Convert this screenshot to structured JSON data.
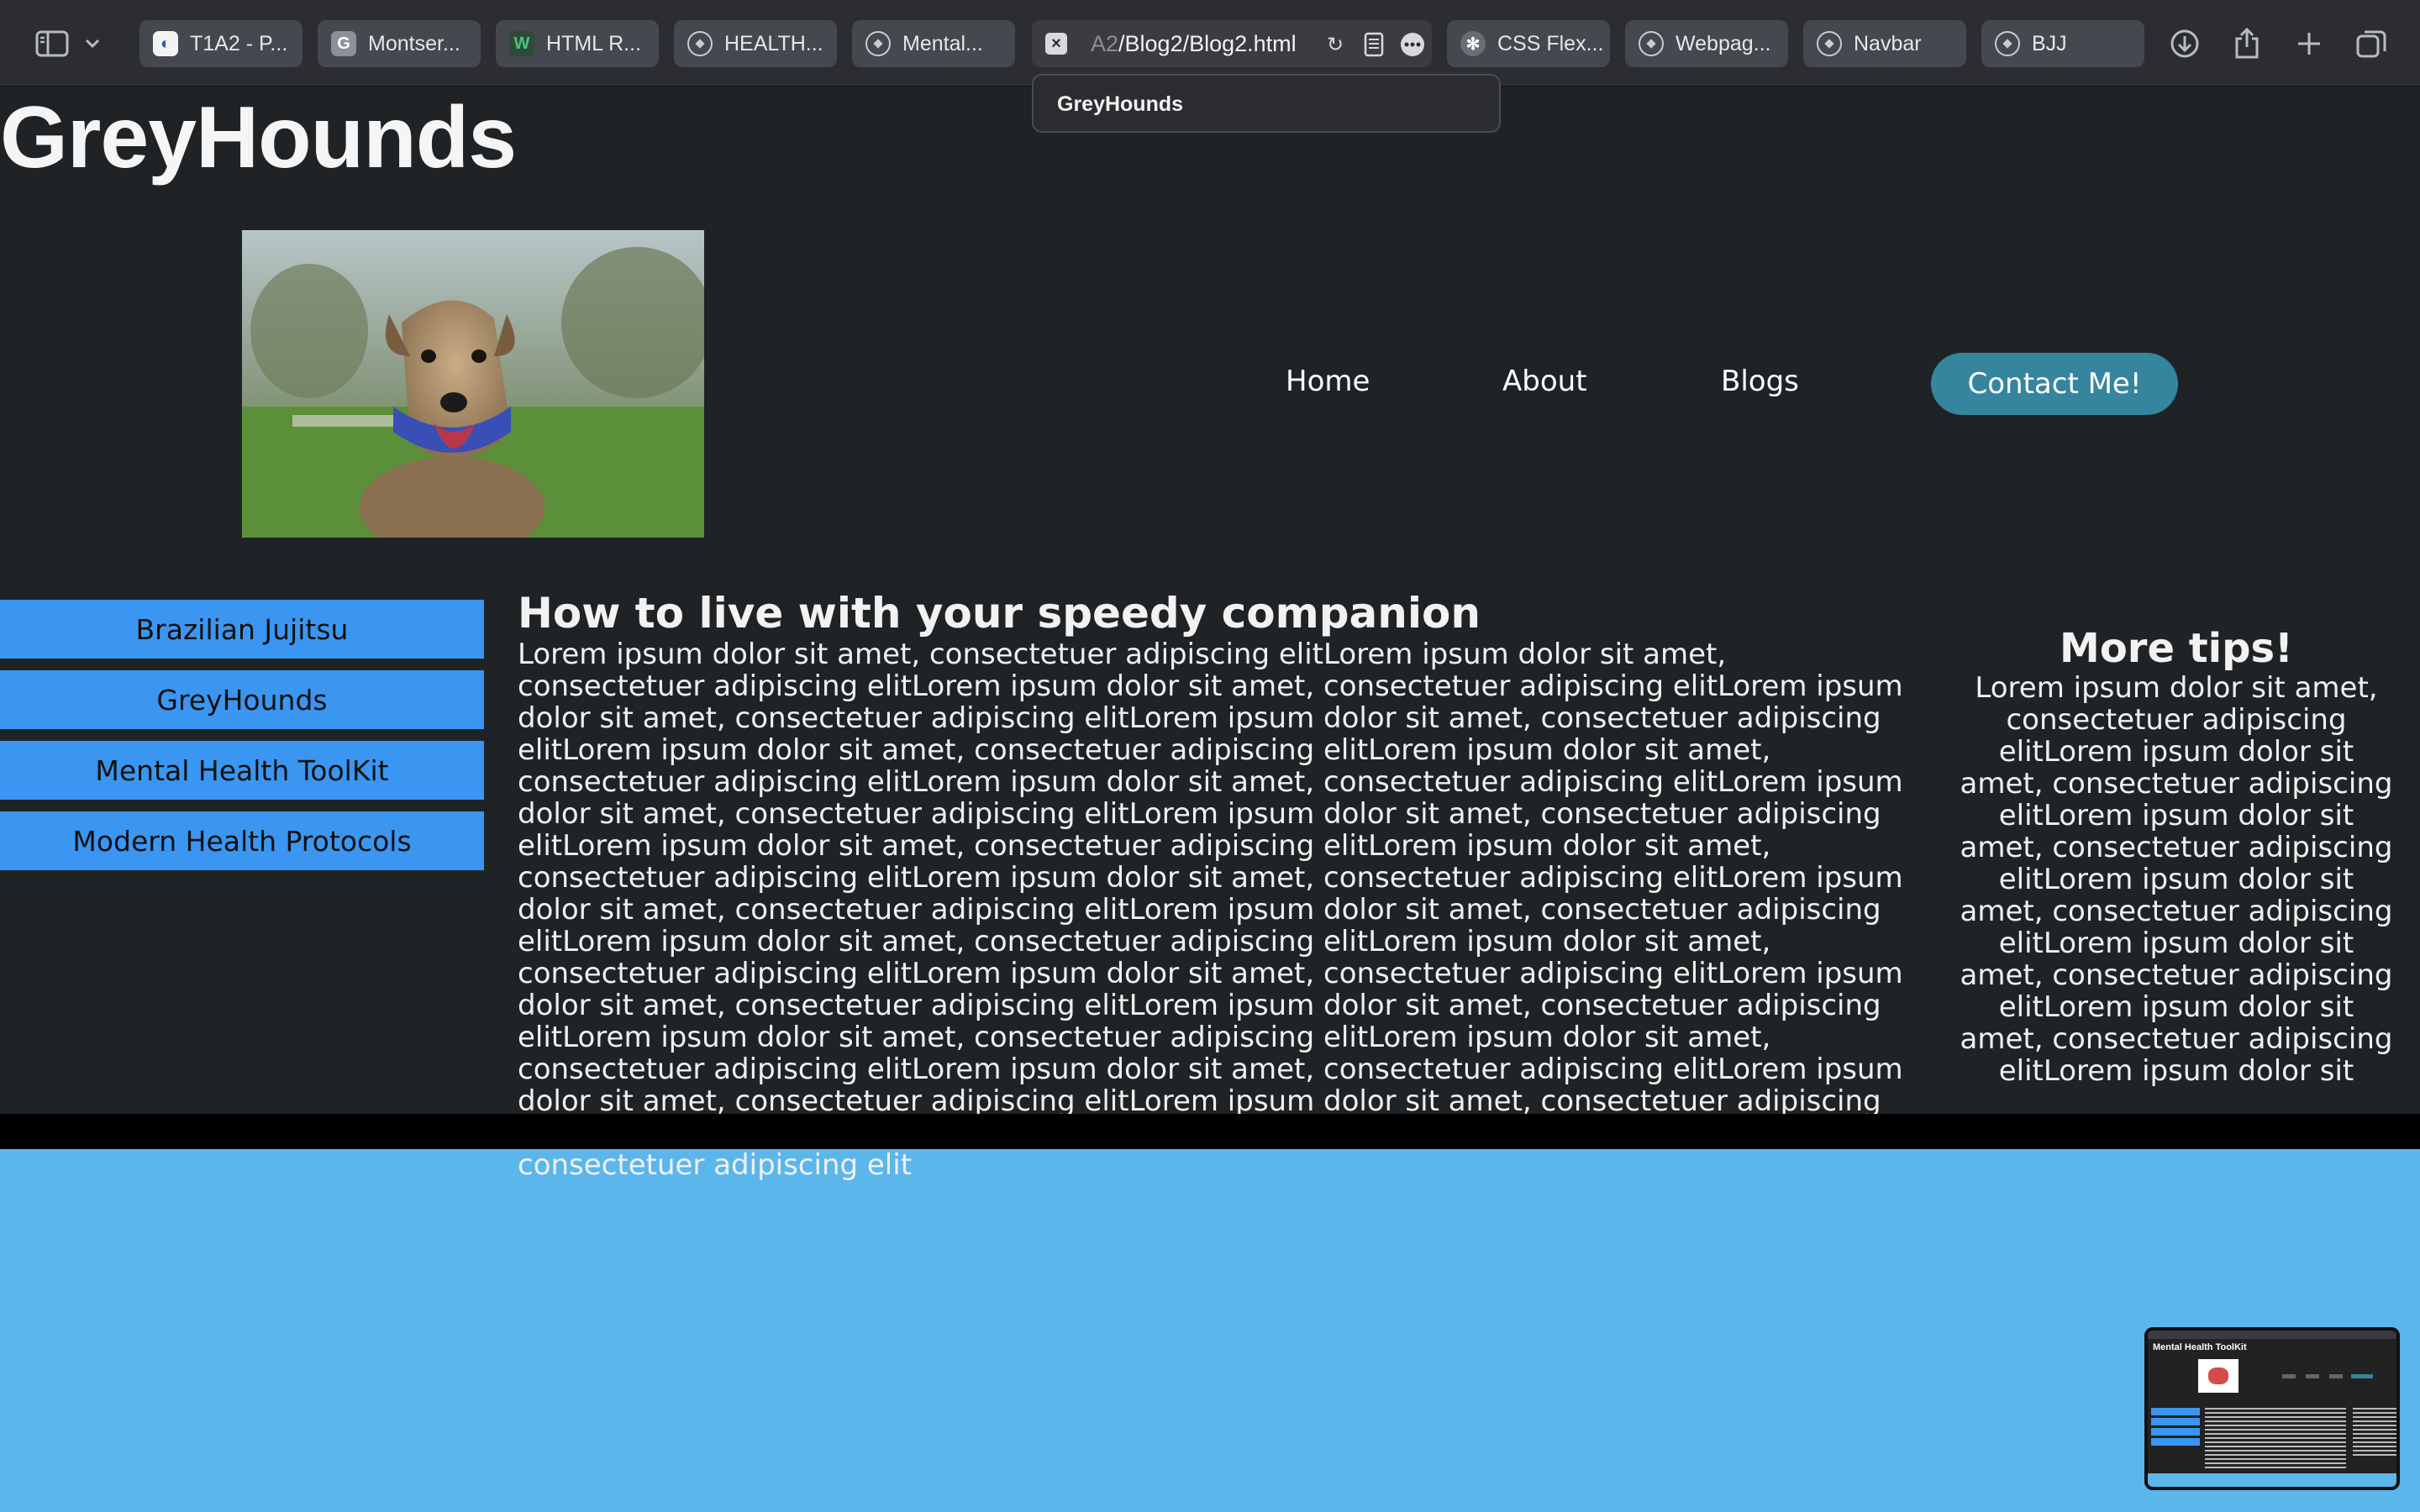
{
  "browser": {
    "tabs": [
      {
        "label": "T1A2 - P...",
        "favicon": "t1a2-favicon"
      },
      {
        "label": "Montser...",
        "favicon": "google-fonts-favicon"
      },
      {
        "label": "HTML R...",
        "favicon": "w3schools-favicon"
      },
      {
        "label": "HEALTH...",
        "favicon": "compass-icon"
      },
      {
        "label": "Mental...",
        "favicon": "compass-icon"
      },
      {
        "label": "CSS Flex...",
        "favicon": "chatgpt-favicon"
      },
      {
        "label": "Webpag...",
        "favicon": "compass-icon"
      },
      {
        "label": "Navbar",
        "favicon": "compass-icon"
      },
      {
        "label": "BJJ",
        "favicon": "compass-icon"
      }
    ],
    "active_tab": {
      "url_dim": "A2",
      "url": "/Blog2/Blog2.html"
    },
    "autocomplete_suggestion": "GreyHounds"
  },
  "site": {
    "title": "GreyHounds",
    "nav": {
      "home": "Home",
      "about": "About",
      "blogs": "Blogs",
      "contact": "Contact Me!"
    },
    "sidebar": [
      "Brazilian Jujitsu",
      "GreyHounds",
      "Mental Health ToolKit",
      "Modern Health Protocols"
    ],
    "article": {
      "heading": "How to live with your speedy companion",
      "body": "Lorem ipsum dolor sit amet, consectetuer adipiscing elitLorem ipsum dolor sit amet, consectetuer adipiscing elitLorem ipsum dolor sit amet, consectetuer adipiscing elitLorem ipsum dolor sit amet, consectetuer adipiscing elitLorem ipsum dolor sit amet, consectetuer adipiscing elitLorem ipsum dolor sit amet, consectetuer adipiscing elitLorem ipsum dolor sit amet, consectetuer adipiscing elitLorem ipsum dolor sit amet, consectetuer adipiscing elitLorem ipsum dolor sit amet, consectetuer adipiscing elitLorem ipsum dolor sit amet, consectetuer adipiscing elitLorem ipsum dolor sit amet, consectetuer adipiscing elitLorem ipsum dolor sit amet, consectetuer adipiscing elitLorem ipsum dolor sit amet, consectetuer adipiscing elitLorem ipsum dolor sit amet, consectetuer adipiscing elitLorem ipsum dolor sit amet, consectetuer adipiscing elitLorem ipsum dolor sit amet, consectetuer adipiscing elitLorem ipsum dolor sit amet, consectetuer adipiscing elitLorem ipsum dolor sit amet, consectetuer adipiscing elitLorem ipsum dolor sit amet, consectetuer adipiscing elitLorem ipsum dolor sit amet, consectetuer adipiscing elitLorem ipsum dolor sit amet, consectetuer adipiscing elitLorem ipsum dolor sit amet, consectetuer adipiscing elitLorem ipsum dolor sit amet, consectetuer adipiscing elitLorem ipsum dolor sit amet, consectetuer adipiscing elitLorem ipsum dolor sit amet, consectetuer adipiscing elitLorem ipsum dolor sit amet, consectetuer adipiscing elitLorem ipsum dolor sit amet, consectetuer adipiscing elit"
    },
    "tips": {
      "heading": "More tips!",
      "body": "Lorem ipsum dolor sit amet, consectetuer adipiscing elitLorem ipsum dolor sit amet, consectetuer adipiscing elitLorem ipsum dolor sit amet, consectetuer adipiscing elitLorem ipsum dolor sit amet, consectetuer adipiscing elitLorem ipsum dolor sit amet, consectetuer adipiscing elitLorem ipsum dolor sit amet, consectetuer adipiscing elitLorem ipsum dolor sit"
    },
    "thumbnail": {
      "title": "Mental Health ToolKit"
    }
  },
  "colors": {
    "page_bg": "#202325",
    "sidebar_button": "#3a96f0",
    "contact_button": "#35859f",
    "footer_area": "#5bb6ec"
  }
}
